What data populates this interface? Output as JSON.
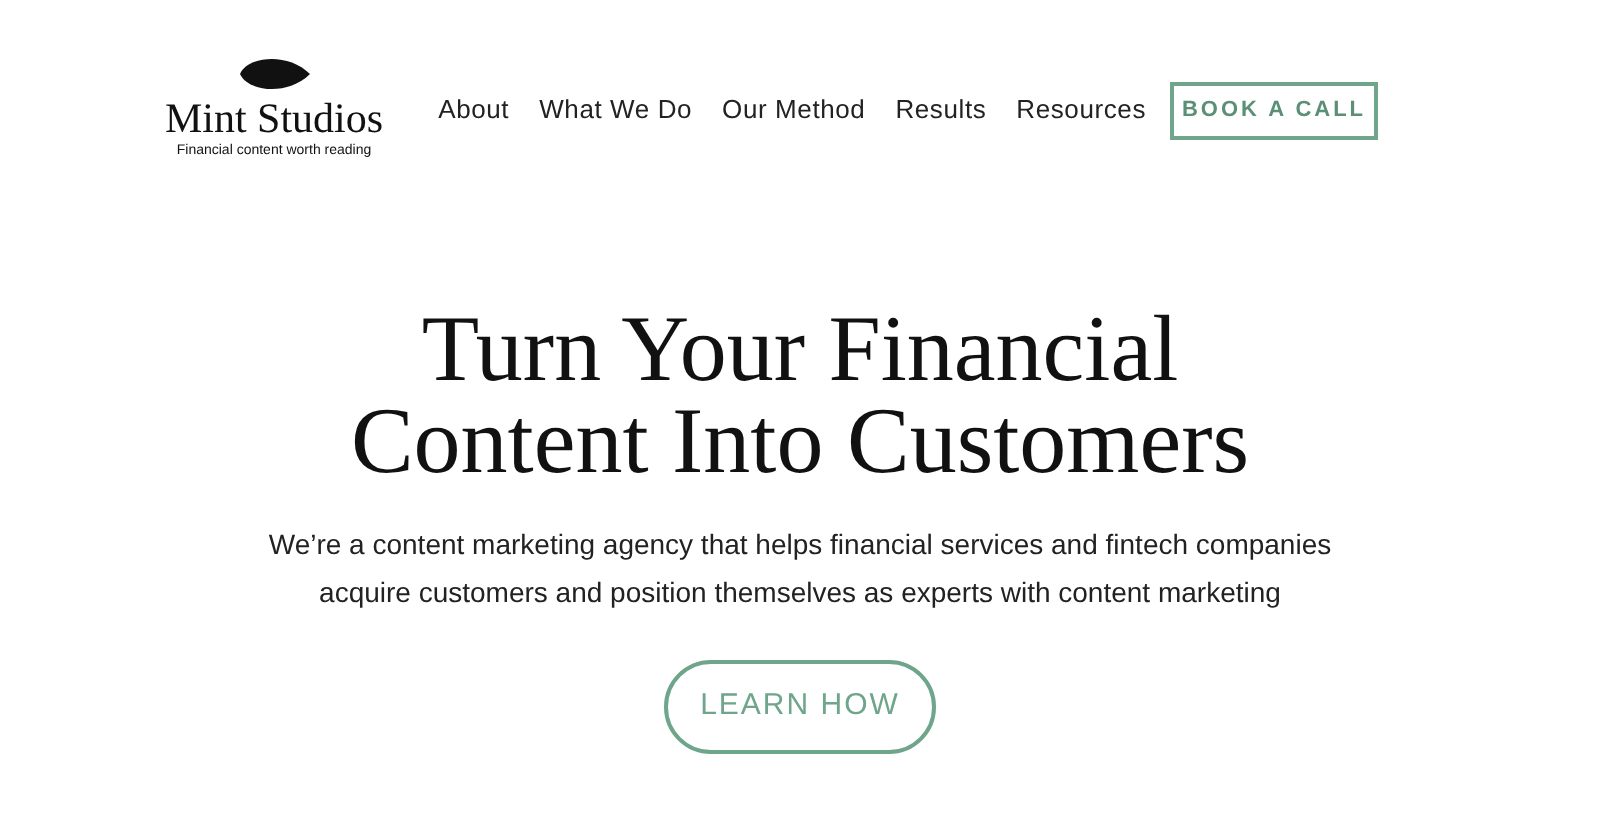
{
  "logo": {
    "name": "Mint Studios",
    "tagline": "Financial content worth reading"
  },
  "nav": [
    {
      "label": "About"
    },
    {
      "label": "What We Do"
    },
    {
      "label": "Our Method"
    },
    {
      "label": "Results"
    },
    {
      "label": "Resources"
    }
  ],
  "cta": "BOOK A CALL",
  "hero": {
    "title_lines": [
      "Turn Your Financial",
      "Content Into Customers"
    ],
    "subtitle_lines": [
      "We’re a content marketing agency that helps financial services and fintech companies",
      "acquire customers and position themselves as experts with content marketing"
    ],
    "button": "LEARN HOW"
  }
}
